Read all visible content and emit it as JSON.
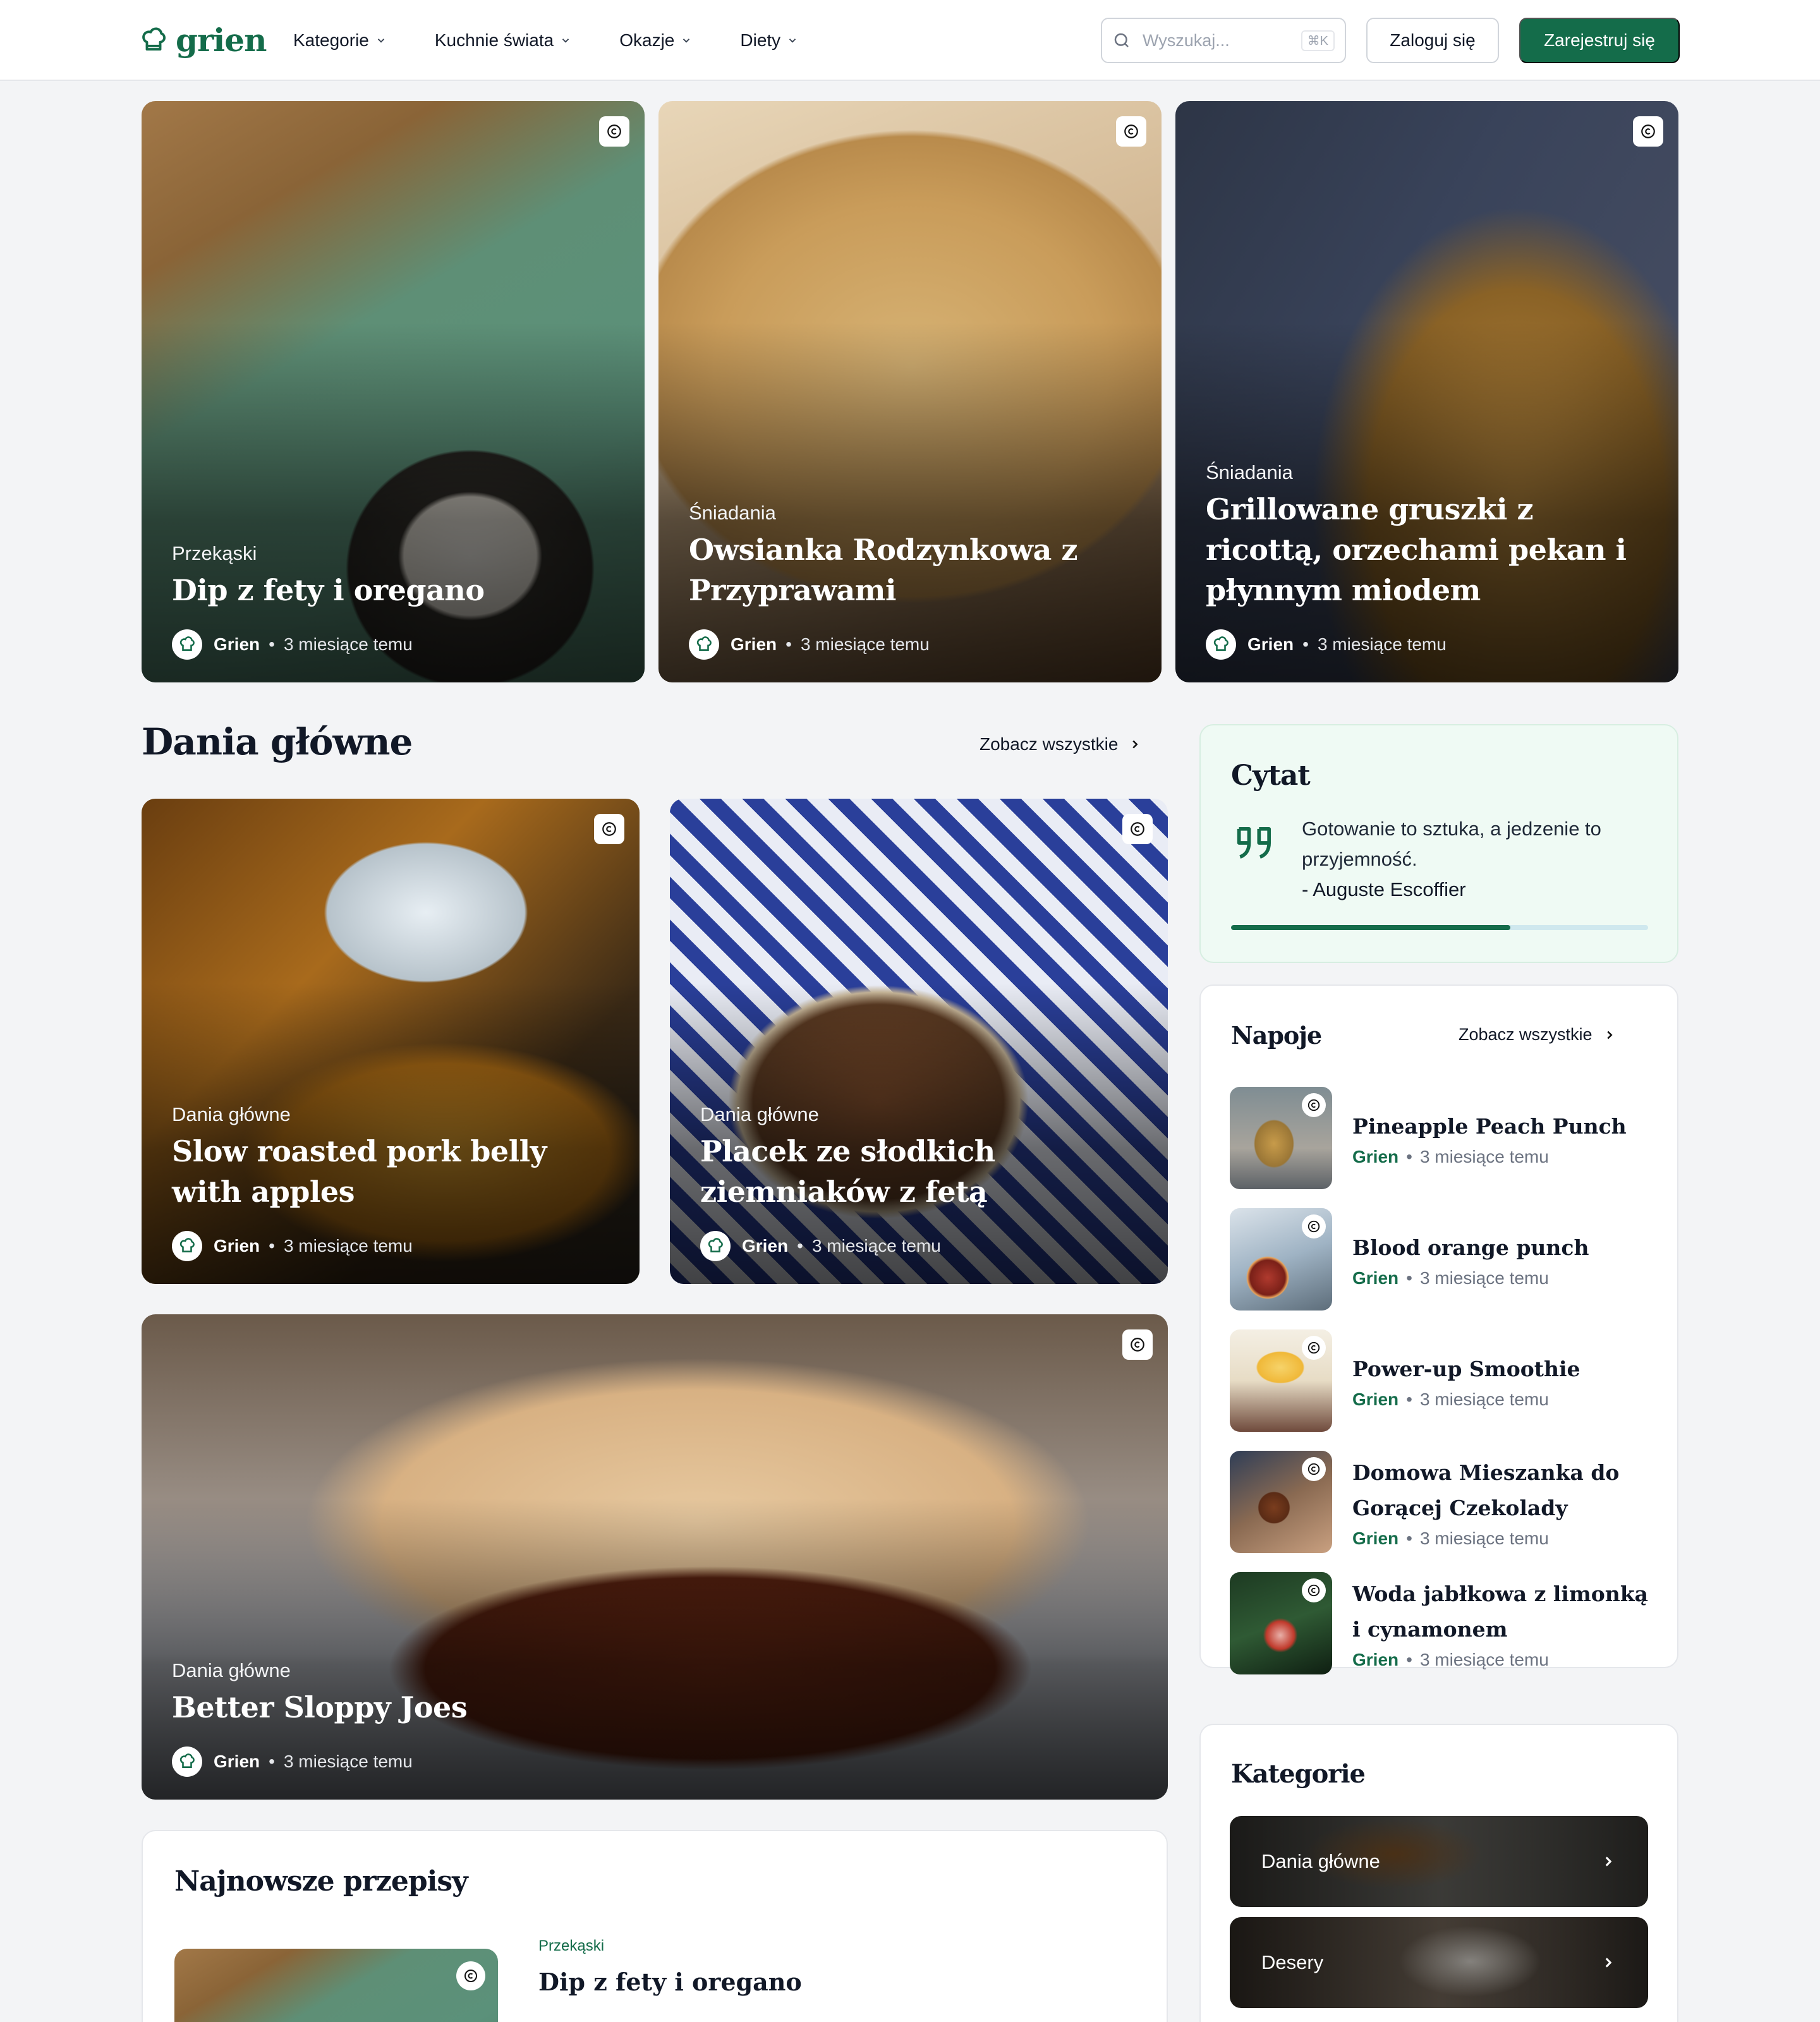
{
  "header": {
    "logo_text": "grien",
    "nav": [
      {
        "label": "Kategorie"
      },
      {
        "label": "Kuchnie świata"
      },
      {
        "label": "Okazje"
      },
      {
        "label": "Diety"
      }
    ],
    "search_placeholder": "Wyszukaj...",
    "search_shortcut": "⌘K",
    "login_label": "Zaloguj się",
    "register_label": "Zarejestruj się"
  },
  "featured": [
    {
      "category": "Przekąski",
      "title": "Dip z fety i oregano",
      "author": "Grien",
      "time": "3 miesiące temu"
    },
    {
      "category": "Śniadania",
      "title": "Owsianka Rodzynkowa z Przyprawami",
      "author": "Grien",
      "time": "3 miesiące temu"
    },
    {
      "category": "Śniadania",
      "title": "Grillowane gruszki z ricottą, orzechami pekan i płynnym miodem",
      "author": "Grien",
      "time": "3 miesiące temu"
    }
  ],
  "main_dishes": {
    "heading": "Dania główne",
    "see_all": "Zobacz wszystkie",
    "items": [
      {
        "category": "Dania główne",
        "title": "Slow roasted pork belly with apples",
        "author": "Grien",
        "time": "3 miesiące temu"
      },
      {
        "category": "Dania główne",
        "title": "Placek ze słodkich ziemniaków z fetą",
        "author": "Grien",
        "time": "3 miesiące temu"
      },
      {
        "category": "Dania główne",
        "title": "Better Sloppy Joes",
        "author": "Grien",
        "time": "3 miesiące temu"
      }
    ]
  },
  "quote": {
    "heading": "Cytat",
    "text": "Gotowanie to sztuka, a jedzenie to przyjemność.",
    "author": "- Auguste Escoffier",
    "progress": 0.67
  },
  "drinks": {
    "heading": "Napoje",
    "see_all": "Zobacz wszystkie",
    "items": [
      {
        "title": "Pineapple Peach Punch",
        "author": "Grien",
        "time": "3 miesiące temu"
      },
      {
        "title": "Blood orange punch",
        "author": "Grien",
        "time": "3 miesiące temu"
      },
      {
        "title": "Power-up Smoothie",
        "author": "Grien",
        "time": "3 miesiące temu"
      },
      {
        "title": "Domowa Mieszanka do Gorącej Czekolady",
        "author": "Grien",
        "time": "3 miesiące temu"
      },
      {
        "title": "Woda jabłkowa z limonką i cynamonem",
        "author": "Grien",
        "time": "3 miesiące temu"
      }
    ]
  },
  "categories": {
    "heading": "Kategorie",
    "items": [
      {
        "label": "Dania główne"
      },
      {
        "label": "Desery"
      }
    ]
  },
  "newest": {
    "heading": "Najnowsze przepisy",
    "items": [
      {
        "category": "Przekąski",
        "title": "Dip z fety i oregano"
      }
    ]
  },
  "colors": {
    "brand": "#146c4a",
    "page_bg": "#f3f4f6",
    "quote_bg": "#effaf4"
  }
}
